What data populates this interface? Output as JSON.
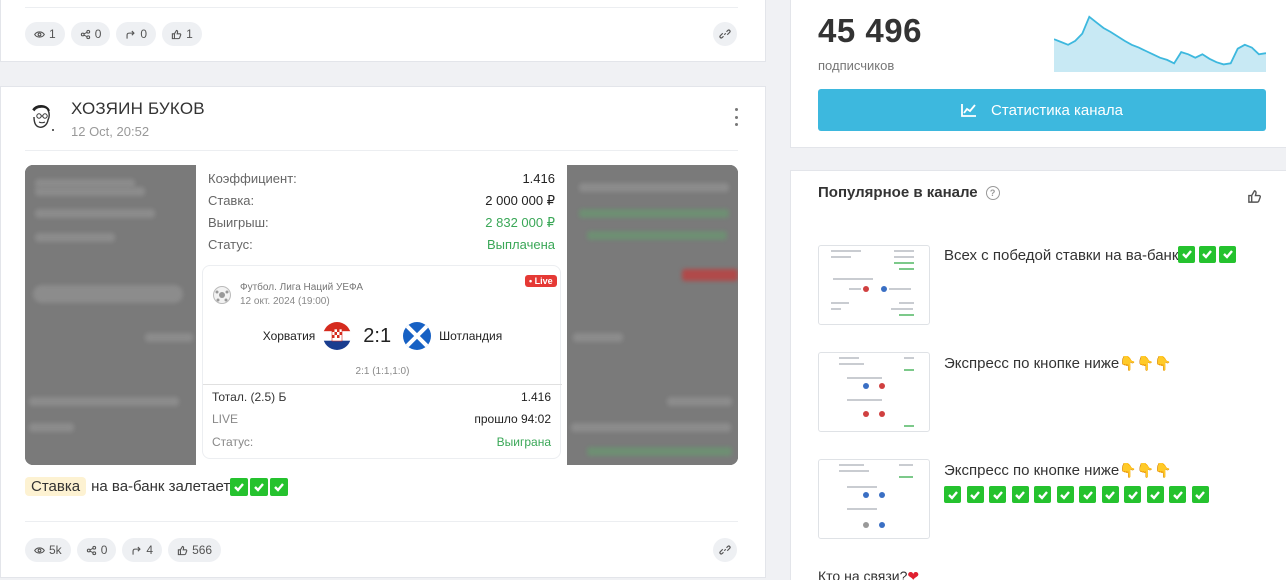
{
  "top_post": {
    "views": "1",
    "shares": "0",
    "forwards": "0",
    "likes": "1"
  },
  "post": {
    "author": "ХОЗЯИН БУКОВ",
    "date": "12 Oct, 20:52",
    "receipt": {
      "rows": [
        {
          "key": "Коэффициент:",
          "value": "1.416"
        },
        {
          "key": "Ставка:",
          "value": "2 000 000 ₽"
        },
        {
          "key": "Выигрыш:",
          "value": "2 832 000 ₽"
        },
        {
          "key": "Статус:",
          "value": "Выплачена"
        }
      ],
      "league": "Футбол. Лига Наций УЕФА",
      "match_date": "12 окт. 2024 (19:00)",
      "live_badge": "• Live",
      "team_home": "Хорватия",
      "score": "2:1",
      "team_away": "Шотландия",
      "halftime": "2:1 (1:1,1:0)",
      "bet_rows": [
        {
          "key": "Тотал. (2.5) Б",
          "value": "1.416"
        },
        {
          "key": "LIVE",
          "value": "прошло 94:02"
        },
        {
          "key": "Статус:",
          "value": "Выиграна"
        }
      ]
    },
    "caption_highlight": "Ставка",
    "caption_text": "на ва-банк залетает",
    "stats": {
      "views": "5k",
      "shares": "0",
      "forwards": "4",
      "likes": "566"
    }
  },
  "channel": {
    "subscribers": "45 496",
    "subscribers_label": "подписчиков",
    "stats_button": "Статистика канала",
    "sparkline": [
      0.45,
      0.5,
      0.55,
      0.48,
      0.35,
      0.05,
      0.15,
      0.25,
      0.32,
      0.4,
      0.48,
      0.55,
      0.6,
      0.66,
      0.72,
      0.78,
      0.82,
      0.88,
      0.68,
      0.72,
      0.78,
      0.72,
      0.8,
      0.86,
      0.9,
      0.88,
      0.62,
      0.55,
      0.6,
      0.72,
      0.7
    ]
  },
  "popular": {
    "title": "Популярное в канале",
    "items": [
      {
        "text": "Всех с победой ставки на ва-банк"
      },
      {
        "text": "Экспресс по кнопке ниже"
      },
      {
        "text": "Экспресс по кнопке ниже"
      }
    ],
    "last_item": "Кто на связи?"
  },
  "colors": {
    "accent": "#3db8de",
    "green": "#3aa757",
    "live_red": "#e53935"
  }
}
